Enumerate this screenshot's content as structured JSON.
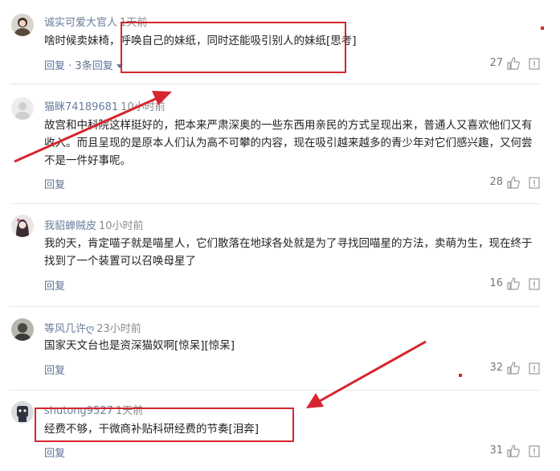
{
  "comments": [
    {
      "username": "诚实可爱大官人",
      "time": "1天前",
      "text": "啥时候卖妹椅，呼唤自己的妹纸，同时还能吸引别人的妹纸[思考]",
      "reply_label": "回复",
      "replies_label": "· 3条回复",
      "likes": "27"
    },
    {
      "username": "猫眯74189681",
      "time": "10小时前",
      "text": "故宫和中科院这样挺好的，把本来严肃深奥的一些东西用亲民的方式呈现出来，普通人又喜欢他们又有收入。而且呈现的是原本人们认为高不可攀的内容，现在吸引越来越多的青少年对它们感兴趣，又何尝不是一件好事呢。",
      "reply_label": "回复",
      "likes": "28"
    },
    {
      "username": "我貂蝉贼皮",
      "time": "10小时前",
      "text": "我的天，肯定喵子就是喵星人，它们散落在地球各处就是为了寻找回喵星的方法，卖萌为生，现在终于找到了一个装置可以召唤母星了",
      "reply_label": "回复",
      "likes": "16"
    },
    {
      "username": "等风几许ღ",
      "time": "23小时前",
      "text": "国家天文台也是资深猫奴啊[惊呆][惊呆]",
      "reply_label": "回复",
      "likes": "32"
    },
    {
      "username": "shutong9527",
      "time": "1天前",
      "text": "经费不够，干微商补贴科研经费的节奏[泪奔]",
      "reply_label": "回复",
      "likes": "31"
    }
  ],
  "icons": {
    "like": "thumbs-up-icon",
    "report": "report-icon"
  },
  "colors": {
    "annotation_red": "#d6252e",
    "username_blue": "#6a7d9c",
    "text": "#222222"
  }
}
